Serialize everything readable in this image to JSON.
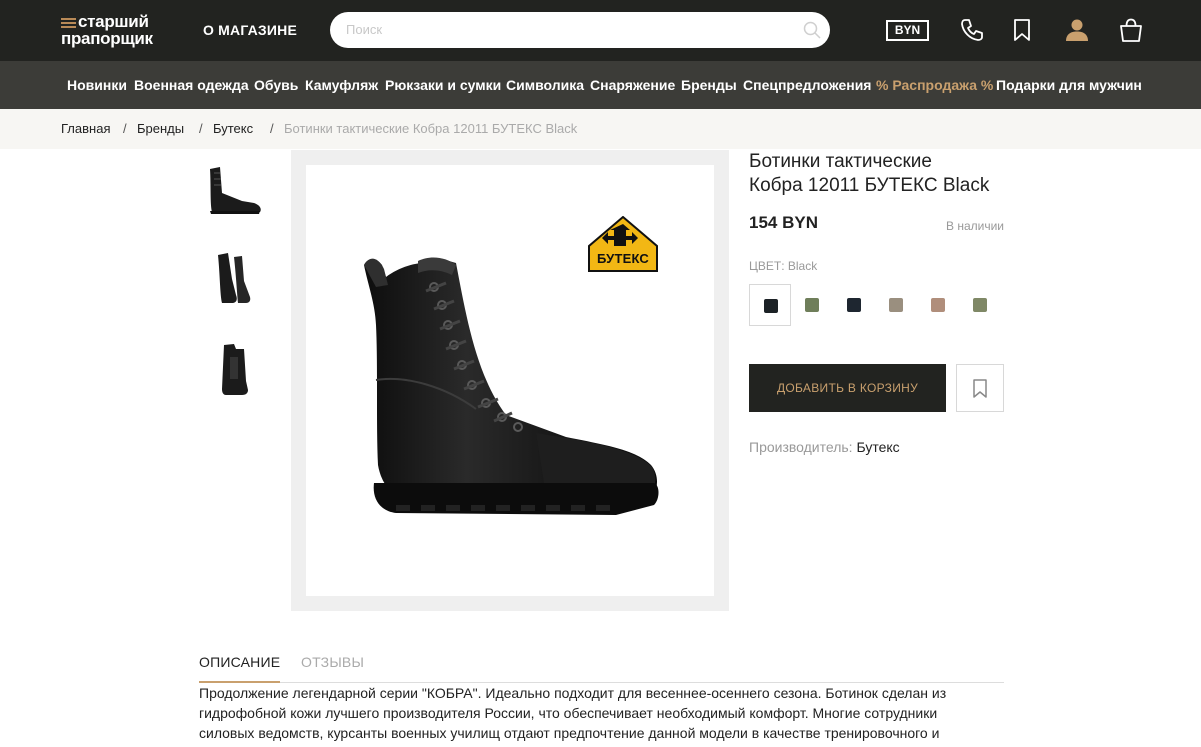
{
  "header": {
    "logo_line1": "старший",
    "logo_line2": "прапорщик",
    "about_link": "О МАГАЗИНЕ",
    "search_placeholder": "Поиск",
    "currency": "BYN"
  },
  "categories": [
    "Новинки",
    "Военная одежда",
    "Обувь",
    "Камуфляж",
    "Рюкзаки и сумки",
    "Символика",
    "Снаряжение",
    "Бренды",
    "Спецпредложения",
    "% Распродажа %",
    "Подарки для мужчин"
  ],
  "breadcrumbs": [
    "Главная",
    "Бренды",
    "Бутекс",
    "Ботинки тактические Кобра 12011 БУТЕКС Black"
  ],
  "breadcrumb_separator": "/",
  "product": {
    "title_line1": "Ботинки тактические",
    "title_line2": "Кобра 12011 БУТЕКС Black",
    "price": "154 BYN",
    "stock": "В наличии",
    "color_label": "ЦВЕТ: Black",
    "colors": [
      "#1c2226",
      "#6f7e5a",
      "#1e2630",
      "#9a8f7f",
      "#b08e7b",
      "#7f8866"
    ],
    "add_to_cart": "ДОБАВИТЬ В КОРЗИНУ",
    "maker_label": "Производитель:",
    "maker_value": "Бутекс",
    "brand_badge": "БУТЕКС"
  },
  "tabs": [
    "ОПИСАНИЕ",
    "ОТЗЫВЫ"
  ],
  "description": [
    " Продолжение легендарной серии \"КОБРА\". Идеально подходит для весеннее-осеннего сезона. Ботинок сделан из",
    "гидрофобной кожи лучшего производителя России, что обеспечивает необходимый комфорт. Многие сотрудники",
    "силовых ведомств, курсанты военных училищ отдают предпочтение данной модели в качестве тренировочного и"
  ],
  "colors": {
    "accent": "#c9a06e",
    "header_bg": "#222320",
    "nav_bg": "#3c3c38"
  }
}
